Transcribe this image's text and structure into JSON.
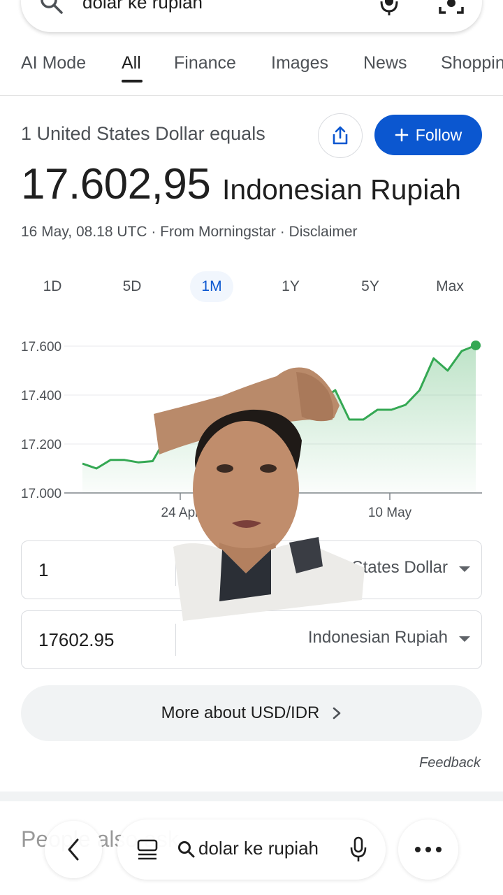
{
  "search": {
    "query": "dolar ke rupiah"
  },
  "tabs": [
    {
      "label": "AI Mode"
    },
    {
      "label": "All"
    },
    {
      "label": "Finance"
    },
    {
      "label": "Images"
    },
    {
      "label": "News"
    },
    {
      "label": "Shoppin"
    }
  ],
  "result": {
    "equals_label": "1 United States Dollar equals",
    "follow_label": "Follow",
    "value": "17.602,95",
    "currency": "Indonesian Rupiah",
    "meta": "16 May, 08.18 UTC · From Morningstar · Disclaimer"
  },
  "ranges": [
    "1D",
    "5D",
    "1M",
    "1Y",
    "5Y",
    "Max"
  ],
  "selected_range": "1M",
  "chart_data": {
    "type": "area",
    "x": [
      0,
      1,
      2,
      3,
      4,
      5,
      6,
      7,
      8,
      9,
      10,
      11,
      12,
      13,
      14,
      15,
      16,
      17,
      18,
      19,
      20,
      21,
      22,
      23,
      24,
      25,
      26,
      27,
      28
    ],
    "y": [
      17120,
      17100,
      17135,
      17135,
      17125,
      17130,
      17230,
      17230,
      17280,
      17310,
      17330,
      17350,
      17370,
      17380,
      17390,
      17400,
      17420,
      17380,
      17420,
      17300,
      17300,
      17340,
      17340,
      17360,
      17420,
      17550,
      17500,
      17580,
      17603
    ],
    "xtick_labels": [
      "24 Apr",
      "10 May"
    ],
    "ytick_labels": [
      "17.600",
      "17.400",
      "17.200",
      "17.000"
    ],
    "ylim": [
      17000,
      17600
    ],
    "color": "#34a853",
    "grid": true
  },
  "converter": {
    "from_value": "1",
    "from_currency": "United States Dollar",
    "to_value": "17602.95",
    "to_currency": "Indonesian Rupiah"
  },
  "more_label": "More about USD/IDR",
  "feedback_label": "Feedback",
  "people_also_ask": "People also ask",
  "bottom_bar": {
    "query": "dolar ke rupiah"
  }
}
